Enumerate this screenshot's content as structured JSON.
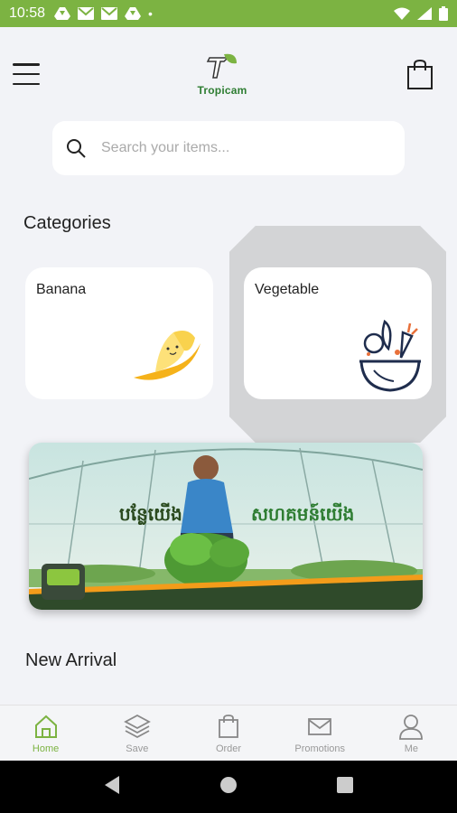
{
  "status_bar": {
    "time": "10:58",
    "dot": "•"
  },
  "header": {
    "logo_text": "Tropicam"
  },
  "search": {
    "placeholder": "Search your items..."
  },
  "sections": {
    "categories": "Categories",
    "new_arrival": "New Arrival"
  },
  "categories": [
    {
      "label": "Banana",
      "icon": "banana-icon"
    },
    {
      "label": "Vegetable",
      "icon": "vegetable-bowl-icon"
    }
  ],
  "banner": {
    "line1": "បន្លែយើង",
    "line2": "សហគមន៍យើង"
  },
  "bottom_nav": [
    {
      "label": "Home",
      "icon": "home-icon",
      "active": true
    },
    {
      "label": "Save",
      "icon": "layers-icon",
      "active": false
    },
    {
      "label": "Order",
      "icon": "bag-icon",
      "active": false
    },
    {
      "label": "Promotions",
      "icon": "mail-icon",
      "active": false
    },
    {
      "label": "Me",
      "icon": "user-icon",
      "active": false
    }
  ],
  "colors": {
    "accent": "#7cb342",
    "background": "#f2f3f7",
    "inactive": "#999999"
  }
}
